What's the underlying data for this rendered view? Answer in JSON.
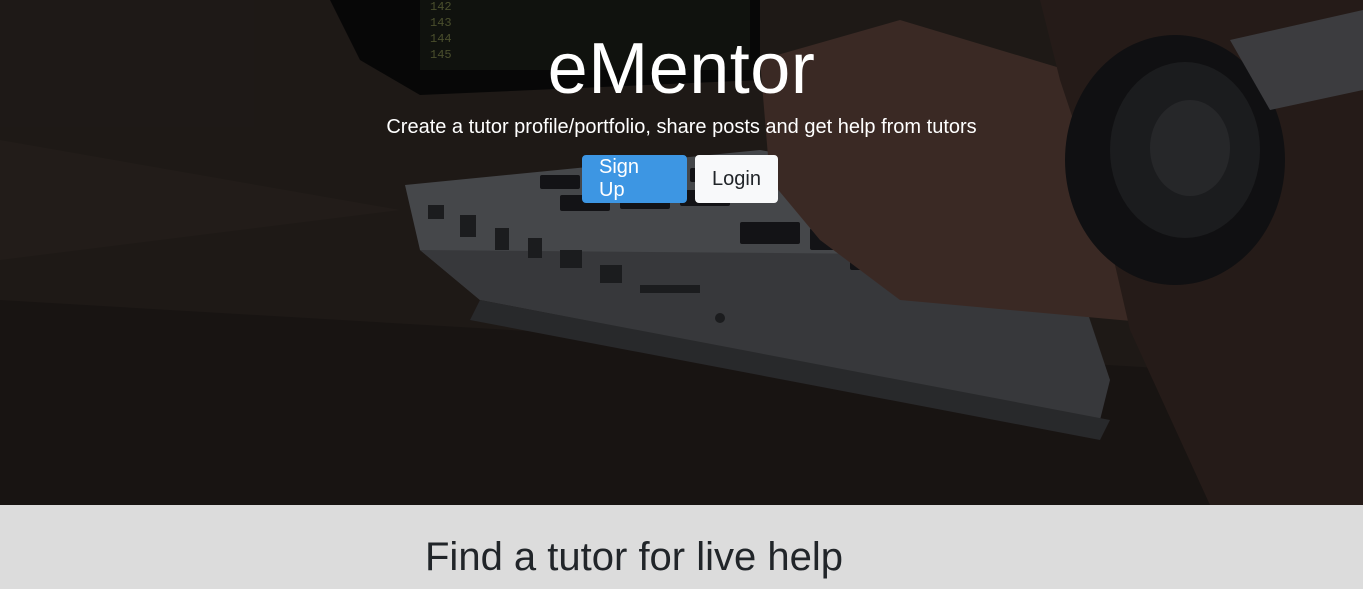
{
  "hero": {
    "title": "eMentor",
    "tagline": "Create a tutor profile/portfolio, share posts and get help from tutors",
    "signup_label": "Sign Up",
    "login_label": "Login"
  },
  "section": {
    "heading": "Find a tutor for live help"
  },
  "colors": {
    "primary": "#3d96e3",
    "light": "#f8f9fa",
    "section_bg": "#dcdcdc",
    "text_dark": "#212529"
  },
  "background_image": "laptop-typing-photo"
}
